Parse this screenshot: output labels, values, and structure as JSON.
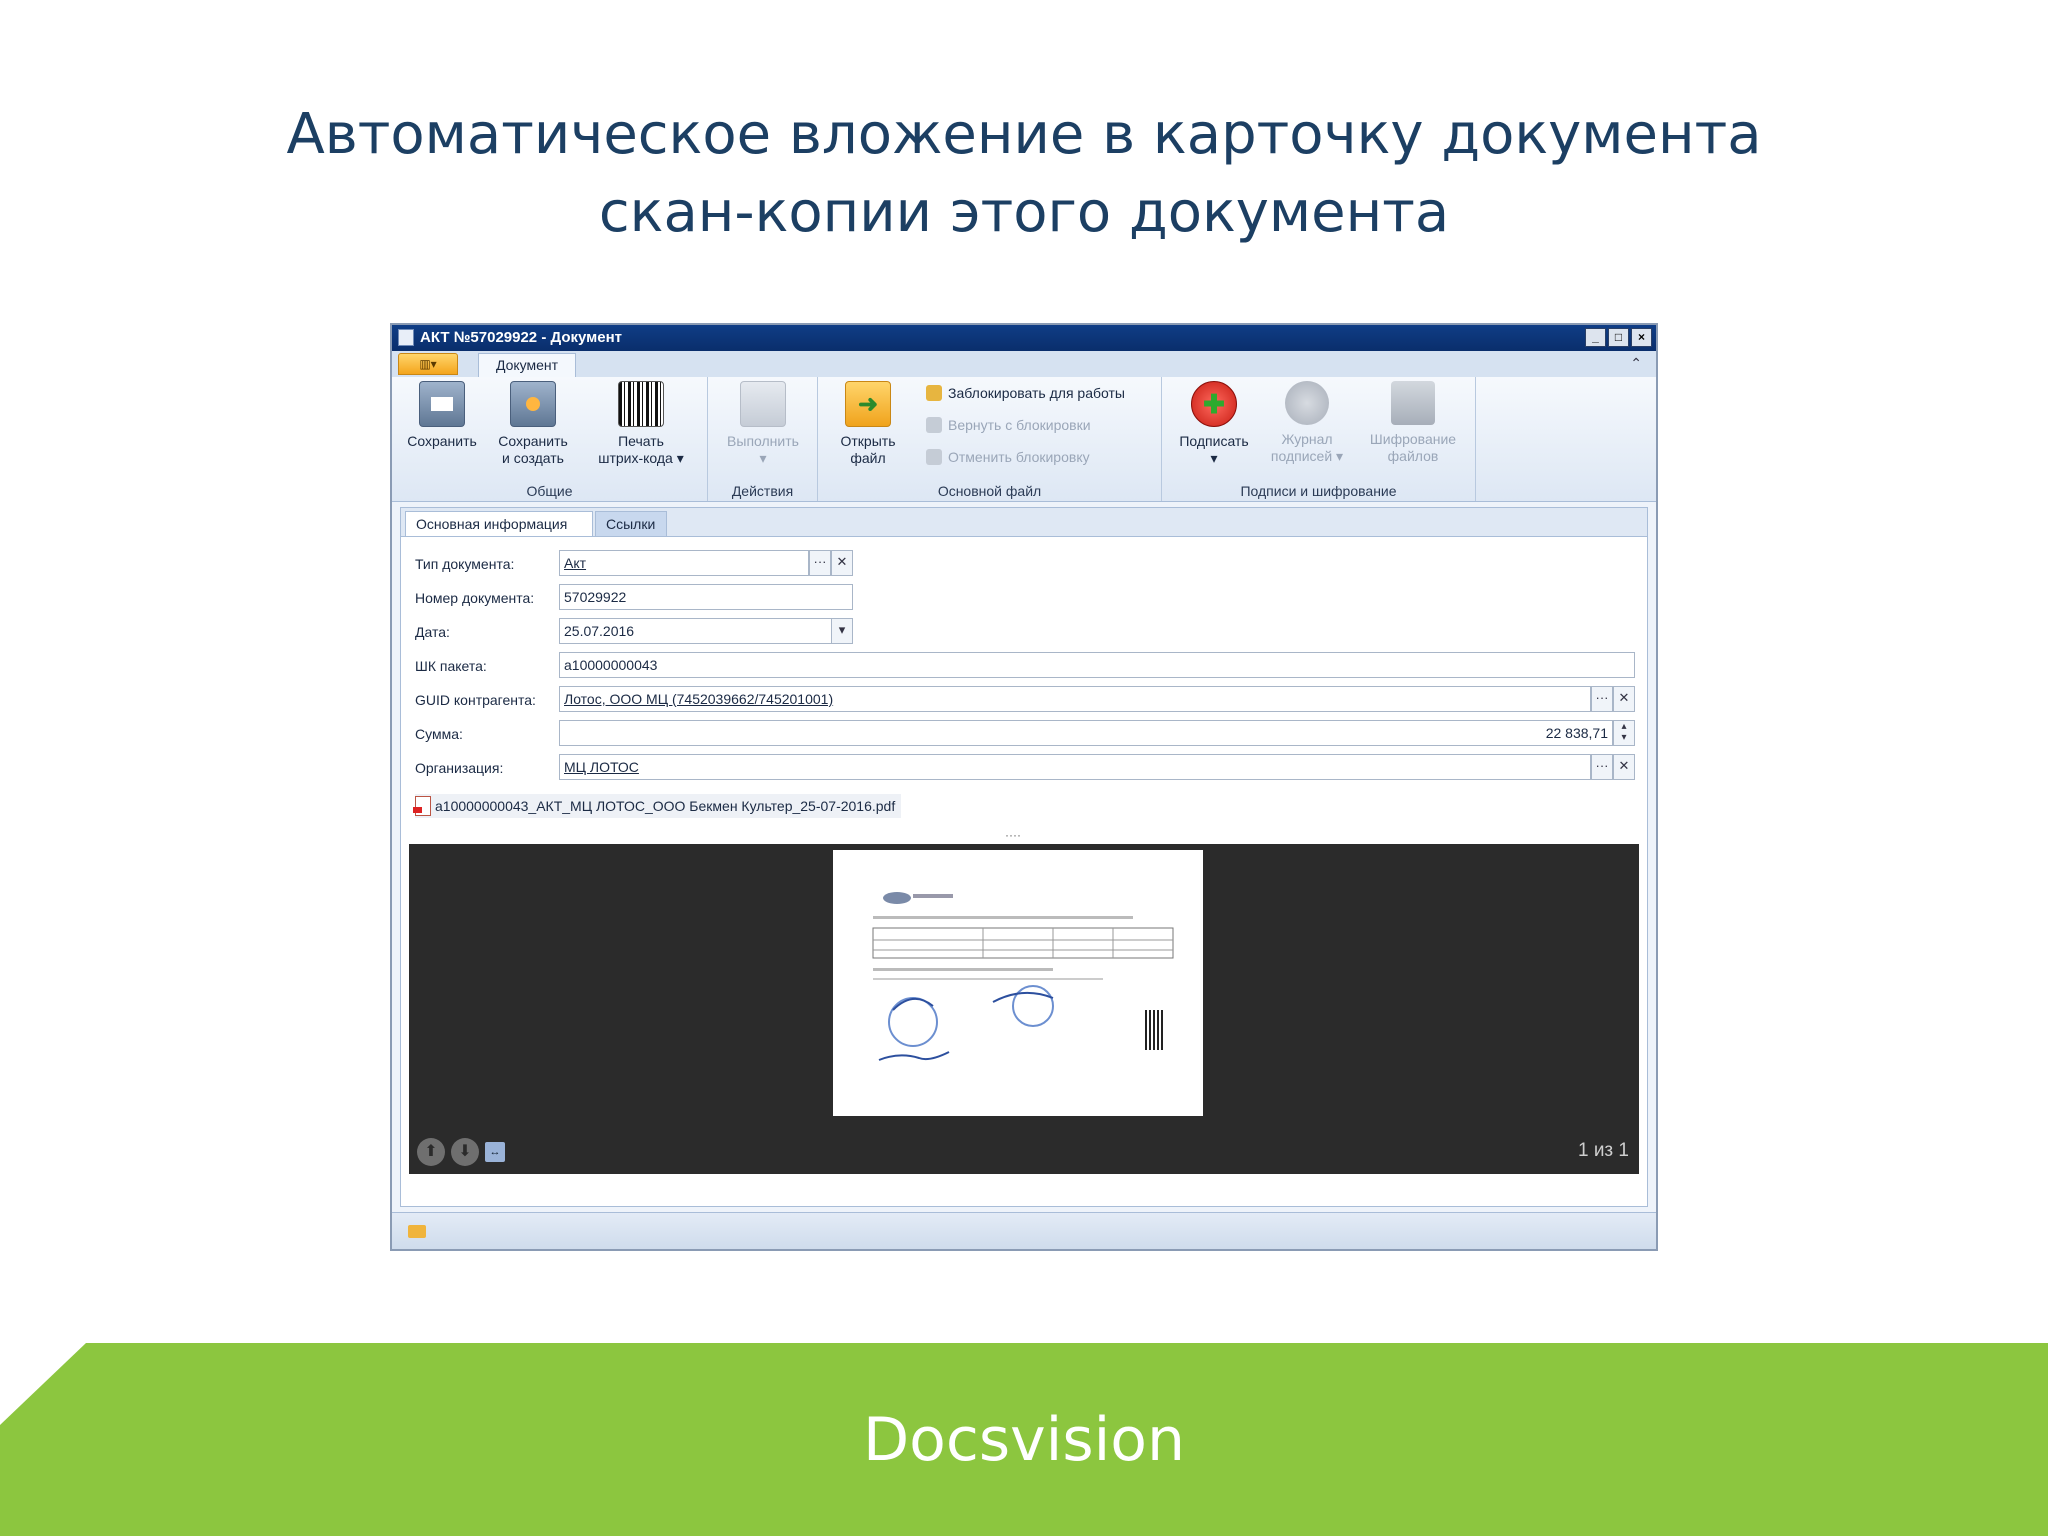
{
  "slide": {
    "title_line1": "Автоматическое вложение в карточку документа",
    "title_line2": "скан-копии этого документа"
  },
  "window": {
    "title": "АКТ №57029922 - Документ",
    "controls": [
      "_",
      "□",
      "×"
    ]
  },
  "tabs": {
    "active": "Документ"
  },
  "ribbon": {
    "groups": {
      "general": "Общие",
      "actions": "Действия",
      "main_file": "Основной файл",
      "signatures": "Подписи и шифрование"
    },
    "buttons": {
      "save": "Сохранить",
      "save_create_1": "Сохранить",
      "save_create_2": "и создать",
      "print_barcode_1": "Печать",
      "print_barcode_2": "штрих-кода ▾",
      "execute": "Выполнить",
      "open_file_1": "Открыть",
      "open_file_2": "файл",
      "lock": "Заблокировать для работы",
      "return_lock": "Вернуть с блокировки",
      "cancel_lock": "Отменить блокировку",
      "sign": "Подписать",
      "sign_log_1": "Журнал",
      "sign_log_2": "подписей ▾",
      "encrypt_1": "Шифрование",
      "encrypt_2": "файлов"
    }
  },
  "form": {
    "tabs": [
      "Основная информация",
      "Ссылки"
    ],
    "fields": {
      "doc_type": {
        "label": "Тип документа:",
        "value": "Акт"
      },
      "doc_number": {
        "label": "Номер документа:",
        "value": "57029922"
      },
      "date": {
        "label": "Дата:",
        "value": "25.07.2016"
      },
      "package_barcode": {
        "label": "ШК пакета:",
        "value": "a10000000043"
      },
      "counterparty_guid": {
        "label": "GUID контрагента:",
        "value": "Лотос, ООО МЦ (7452039662/745201001)"
      },
      "amount": {
        "label": "Сумма:",
        "value": "22 838,71"
      },
      "organization": {
        "label": "Организация:",
        "value": "МЦ ЛОТОС"
      }
    },
    "attachment": "a10000000043_АКТ_МЦ ЛОТОС_ООО Бекмен Культер_25-07-2016.pdf"
  },
  "viewer": {
    "page_count": "1 из 1"
  },
  "footer": {
    "brand": "Docsvision",
    "color": "#8cc63f"
  }
}
